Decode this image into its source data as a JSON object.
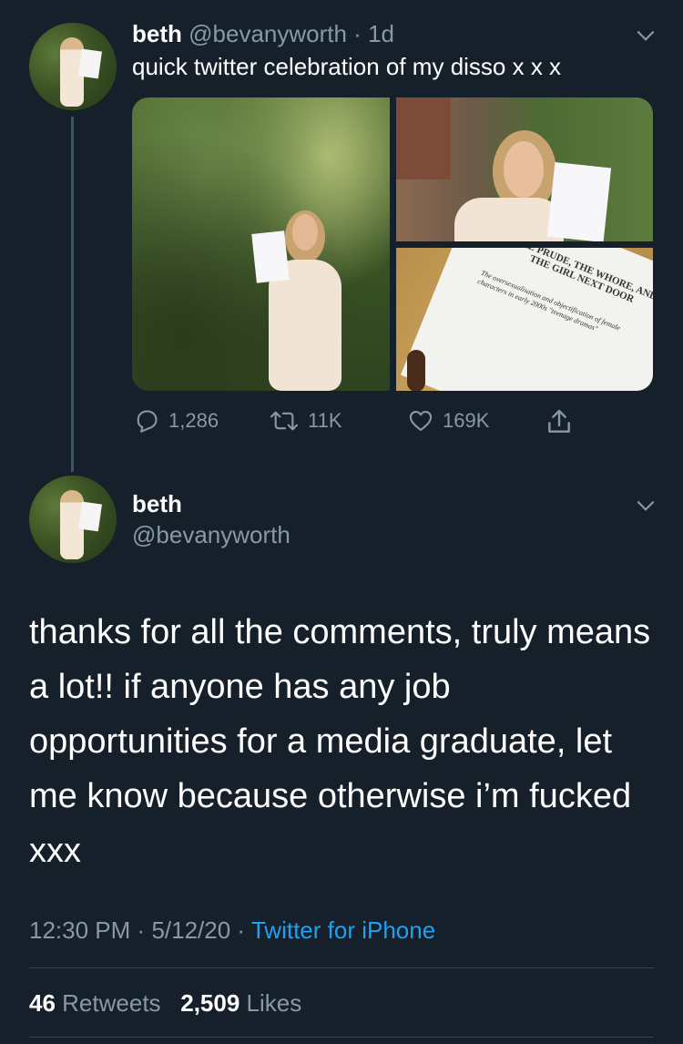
{
  "tweet1": {
    "name": "beth",
    "handle": "@bevanyworth",
    "time": "1d",
    "separator": "·",
    "text": "quick twitter celebration of my disso x x x",
    "doc_title": "THE PRUDE, THE WHORE, AND THE GIRL NEXT DOOR",
    "doc_subtitle": "The oversexualisation and objectification of female characters in early 2000s \"teenage dramas\"",
    "actions": {
      "replies": "1,286",
      "retweets": "11K",
      "likes": "169K"
    }
  },
  "tweet2": {
    "name": "beth",
    "handle": "@bevanyworth",
    "text": "thanks for all the comments, truly means a lot!! if anyone has any job opportunities for a media graduate, let me know because otherwise i’m fucked xxx",
    "time": "12:30 PM",
    "date": "5/12/20",
    "separator": "·",
    "source": "Twitter for iPhone",
    "retweet_count": "46",
    "retweet_label": "Retweets",
    "like_count": "2,509",
    "like_label": "Likes"
  },
  "icons": [
    "chevron-down-icon",
    "reply-icon",
    "retweet-icon",
    "like-icon",
    "share-icon"
  ],
  "colors": {
    "background": "#15202b",
    "muted": "#8899a6",
    "link": "#1da1f2",
    "divider": "#38444d"
  }
}
